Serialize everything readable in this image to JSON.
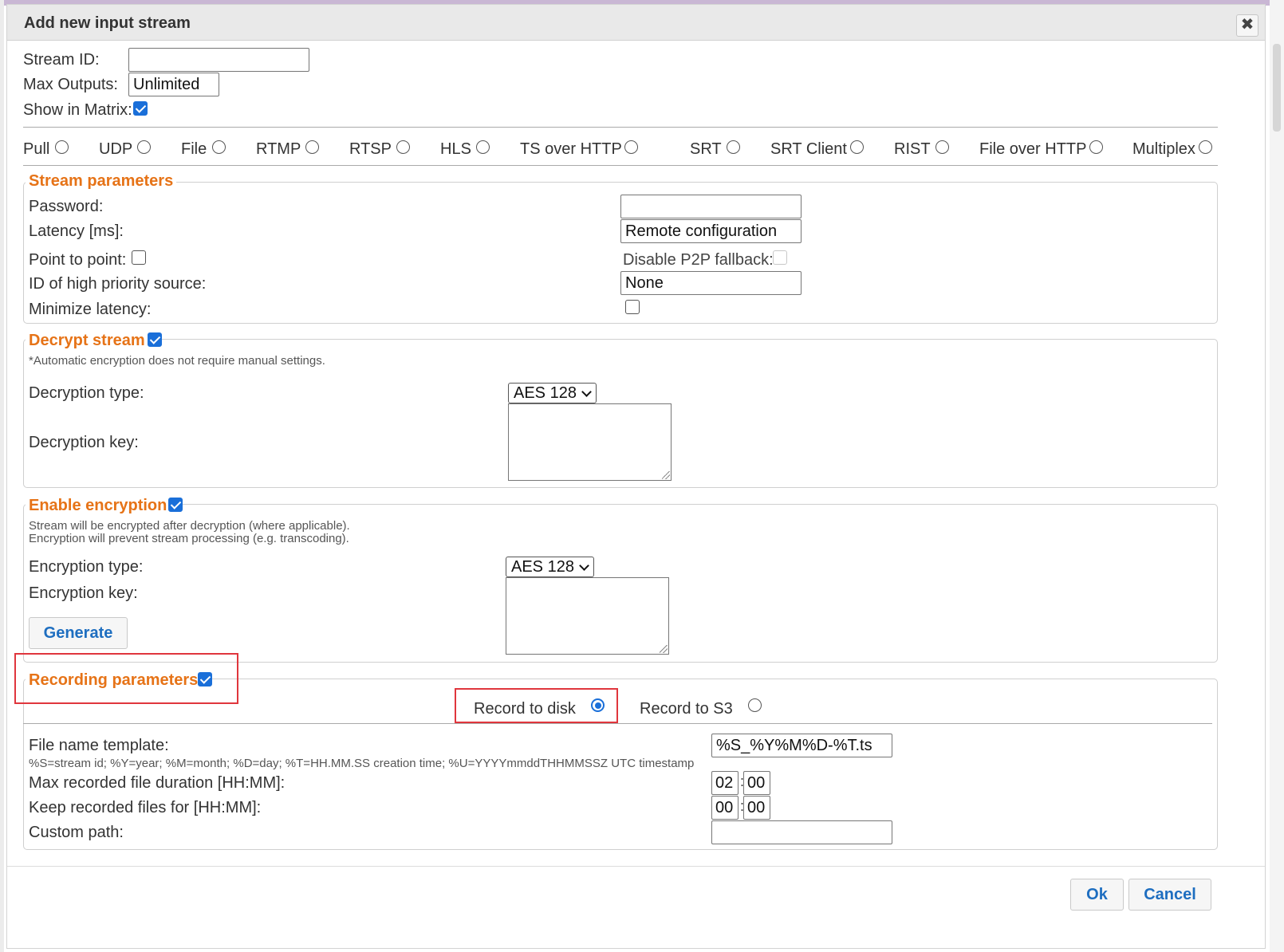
{
  "dialog": {
    "title": "Add new input stream",
    "close_label": "✖"
  },
  "top": {
    "stream_id_label": "Stream ID:",
    "stream_id_value": "",
    "max_outputs_label": "Max Outputs:",
    "max_outputs_value": "Unlimited",
    "show_in_matrix_label": "Show in Matrix:",
    "show_in_matrix_checked": true
  },
  "protocols": [
    {
      "label": "Pull",
      "selected": false
    },
    {
      "label": "UDP",
      "selected": false
    },
    {
      "label": "File",
      "selected": false
    },
    {
      "label": "RTMP",
      "selected": false
    },
    {
      "label": "RTSP",
      "selected": false
    },
    {
      "label": "HLS",
      "selected": false
    },
    {
      "label": "TS over HTTP",
      "selected": false
    },
    {
      "label": "SRT",
      "selected": false
    },
    {
      "label": "SRT Client",
      "selected": false
    },
    {
      "label": "RIST",
      "selected": false
    },
    {
      "label": "File over HTTP",
      "selected": false
    },
    {
      "label": "Multiplex",
      "selected": false
    }
  ],
  "stream_params": {
    "legend": "Stream parameters",
    "password_label": "Password:",
    "password_value": "",
    "latency_label": "Latency [ms]:",
    "latency_value": "Remote configuration",
    "p2p_label": "Point to point:",
    "p2p_checked": false,
    "disable_p2p_fallback_label": "Disable P2P fallback:",
    "disable_p2p_fallback_checked": false,
    "high_priority_label": "ID of high priority source:",
    "high_priority_value": "None",
    "minimize_latency_label": "Minimize latency:",
    "minimize_latency_checked": false
  },
  "decrypt": {
    "legend": "Decrypt stream",
    "checked": true,
    "note": "*Automatic encryption does not require manual settings.",
    "type_label": "Decryption type:",
    "type_value": "AES 128",
    "key_label": "Decryption key:",
    "key_value": ""
  },
  "encrypt": {
    "legend": "Enable encryption",
    "checked": true,
    "note_line1": "Stream will be encrypted after decryption (where applicable).",
    "note_line2": "Encryption will prevent stream processing (e.g. transcoding).",
    "type_label": "Encryption type:",
    "type_value": "AES 128",
    "key_label": "Encryption key:",
    "key_value": "",
    "generate_label": "Generate"
  },
  "recording": {
    "legend": "Recording parameters",
    "checked": true,
    "record_disk_label": "Record to disk",
    "record_disk_selected": true,
    "record_s3_label": "Record to S3",
    "record_s3_selected": false,
    "template_label": "File name template:",
    "template_value": "%S_%Y%M%D-%T.ts",
    "template_help": "%S=stream id; %Y=year; %M=month; %D=day; %T=HH.MM.SS creation time; %U=YYYYmmddTHHMMSSZ UTC timestamp",
    "max_duration_label": "Max recorded file duration [HH:MM]:",
    "max_duration_hh": "02",
    "max_duration_mm": "00",
    "keep_label": "Keep recorded files for [HH:MM]:",
    "keep_hh": "00",
    "keep_mm": "00",
    "custom_path_label": "Custom path:",
    "custom_path_value": ""
  },
  "footer": {
    "ok_label": "Ok",
    "cancel_label": "Cancel"
  }
}
